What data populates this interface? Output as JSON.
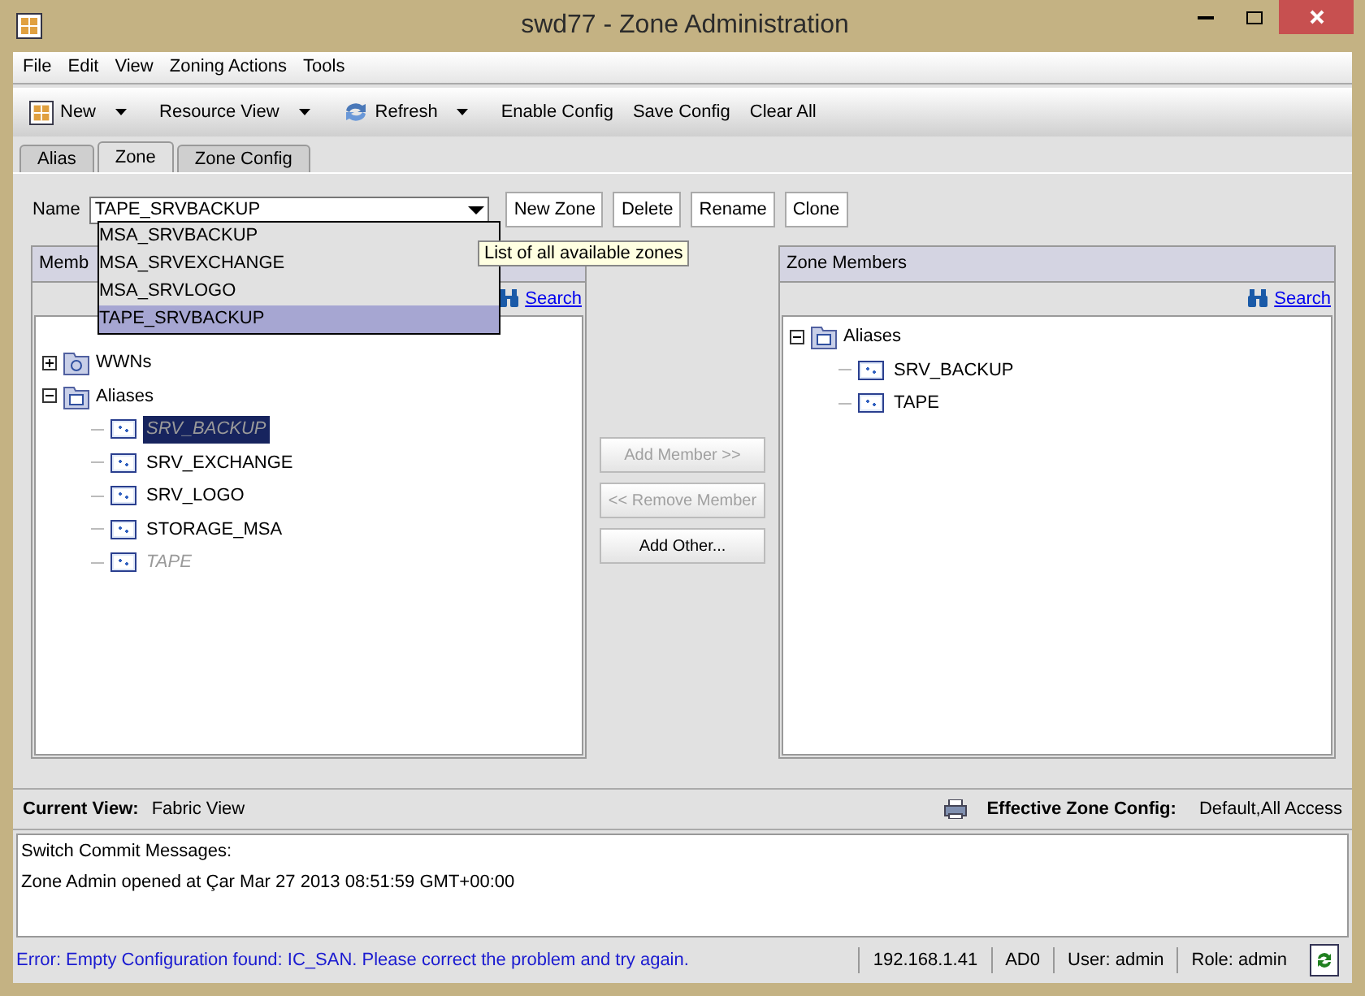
{
  "window": {
    "title": "swd77 - Zone Administration"
  },
  "menu": [
    "File",
    "Edit",
    "View",
    "Zoning Actions",
    "Tools"
  ],
  "toolbar": [
    {
      "label": "New",
      "kind": "new",
      "dropdown": true
    },
    {
      "label": "Resource View",
      "kind": "plain",
      "dropdown": true
    },
    {
      "label": "Refresh",
      "kind": "refresh",
      "dropdown": true
    },
    {
      "label": "Enable Config",
      "kind": "plain",
      "dropdown": false
    },
    {
      "label": "Save Config",
      "kind": "plain",
      "dropdown": false
    },
    {
      "label": "Clear All",
      "kind": "plain",
      "dropdown": false
    }
  ],
  "tabs": [
    {
      "label": "Alias",
      "selected": false
    },
    {
      "label": "Zone",
      "selected": true
    },
    {
      "label": "Zone Config",
      "selected": false
    }
  ],
  "name_field": {
    "label": "Name",
    "value": "TAPE_SRVBACKUP",
    "expanded": true,
    "options": [
      {
        "label": "MSA_SRVBACKUP",
        "selected": false
      },
      {
        "label": "MSA_SRVEXCHANGE",
        "selected": false
      },
      {
        "label": "MSA_SRVLOGO",
        "selected": false
      },
      {
        "label": "TAPE_SRVBACKUP",
        "selected": true
      }
    ]
  },
  "tooltip": "List of all available zones",
  "zone_buttons": [
    "New Zone",
    "Delete",
    "Rename",
    "Clone"
  ],
  "left_panel": {
    "title": "Memb",
    "search": "Search",
    "tree": [
      {
        "label": "WWNs",
        "kind": "wwn",
        "expanded": false
      },
      {
        "label": "Aliases",
        "kind": "folder",
        "expanded": true,
        "children": [
          {
            "label": "SRV_BACKUP",
            "selected": true,
            "disabled": true
          },
          {
            "label": "SRV_EXCHANGE",
            "selected": false,
            "disabled": false
          },
          {
            "label": "SRV_LOGO",
            "selected": false,
            "disabled": false
          },
          {
            "label": "STORAGE_MSA",
            "selected": false,
            "disabled": false
          },
          {
            "label": "TAPE",
            "selected": false,
            "disabled": true
          }
        ]
      }
    ]
  },
  "middle_buttons": [
    {
      "label": "Add Member >>",
      "disabled": true
    },
    {
      "label": "<< Remove Member",
      "disabled": true
    },
    {
      "label": "Add Other...",
      "disabled": false
    }
  ],
  "right_panel": {
    "title": "Zone Members",
    "search": "Search",
    "tree": [
      {
        "label": "Aliases",
        "kind": "folder",
        "expanded": true,
        "children": [
          {
            "label": "SRV_BACKUP",
            "selected": false,
            "disabled": false
          },
          {
            "label": "TAPE",
            "selected": false,
            "disabled": false
          }
        ]
      }
    ]
  },
  "view_bar": {
    "current_label": "Current View:",
    "current_value": "Fabric View",
    "effective_label": "Effective Zone Config:",
    "effective_value": "Default,All Access"
  },
  "messages": [
    "Switch Commit Messages:",
    "Zone Admin opened at Çar Mar 27 2013 08:51:59 GMT+00:00"
  ],
  "status_bar": {
    "error": "Error: Empty Configuration found: IC_SAN. Please correct the problem and try again.",
    "cells": [
      "192.168.1.41",
      "AD0",
      "User: admin",
      "Role: admin"
    ]
  }
}
